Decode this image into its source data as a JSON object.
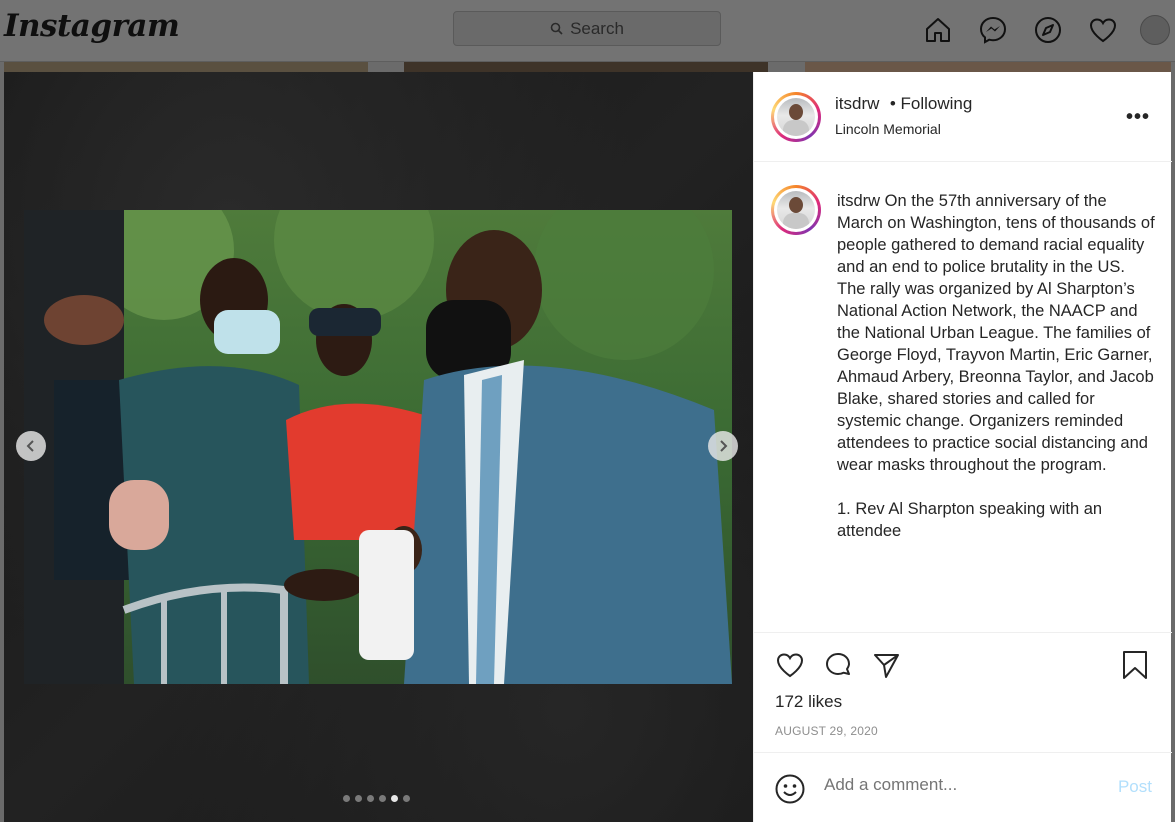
{
  "nav": {
    "logo": "Instagram",
    "search_placeholder": "Search"
  },
  "post": {
    "username": "itsdrw",
    "follow_status": "• Following",
    "location": "Lincoln Memorial",
    "caption_username": "itsdrw",
    "caption_text": " On the 57th anniversary of the March on Washington, tens of thousands of people gathered to demand racial equality and an end to police brutality in the US. The rally was organized by Al Sharpton’s National Action Network, the NAACP and the National Urban League. The families of George Floyd, Trayvon Martin, Eric Garner, Ahmaud Arbery, Breonna Taylor, and Jacob Blake, shared stories and called for systemic change. Organizers reminded attendees to practice social distancing and wear masks throughout the program.\n\n1. Rev Al Sharpton speaking with an attendee",
    "likes": "172 likes",
    "date": "AUGUST 29, 2020",
    "comment_placeholder": "Add a comment...",
    "post_label": "Post"
  },
  "carousel": {
    "dot_count": 6,
    "active_index": 4
  },
  "colors": {
    "post_button": "#b2dffc",
    "muted_text": "#8e8e8e"
  }
}
